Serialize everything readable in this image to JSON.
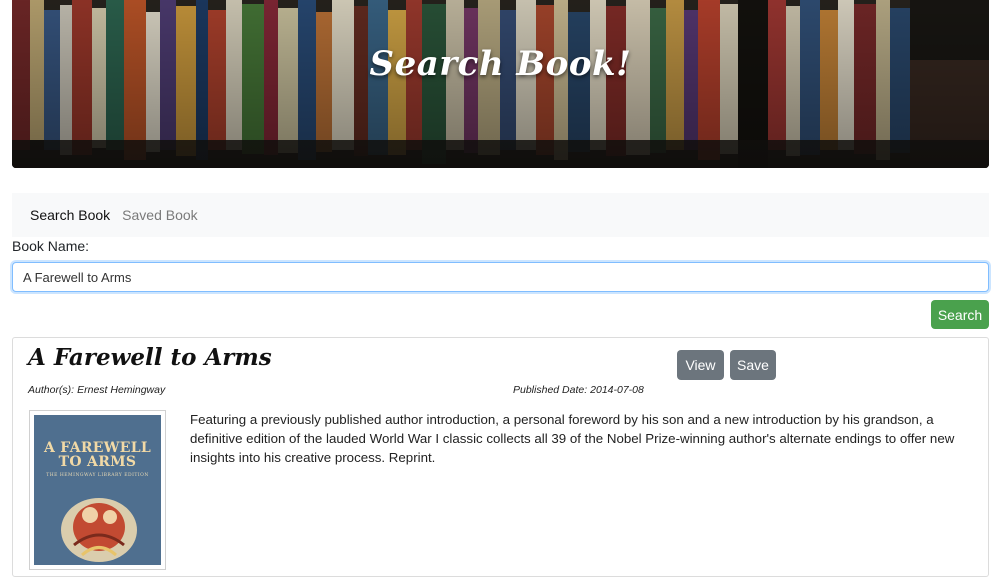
{
  "hero": {
    "title": "Search Book!"
  },
  "nav": {
    "items": [
      {
        "label": "Search Book",
        "active": true
      },
      {
        "label": "Saved Book",
        "active": false
      }
    ]
  },
  "form": {
    "label": "Book Name:",
    "value": "A Farewell to Arms",
    "search_button": "Search"
  },
  "result": {
    "title": "A Farewell to Arms",
    "view_button": "View",
    "save_button": "Save",
    "authors_key": "Author(s):",
    "authors_value": "Ernest Hemingway",
    "published_key": "Published Date:",
    "published_value": "2014-07-08",
    "description": "Featuring a previously published author introduction, a personal foreword by his son and a new introduction by his grandson, a definitive edition of the lauded World War I classic collects all 39 of the Nobel Prize-winning author's alternate endings to offer new insights into his creative process. Reprint.",
    "cover": {
      "title_line1": "A FAREWELL",
      "title_line2": "TO ARMS",
      "subtitle": "THE HEMINGWAY LIBRARY EDITION"
    }
  },
  "colors": {
    "search_button": "#4aa14d",
    "secondary_button": "#6c757d",
    "nav_background": "#f8f9fa",
    "input_focus_border": "#80bdff"
  }
}
